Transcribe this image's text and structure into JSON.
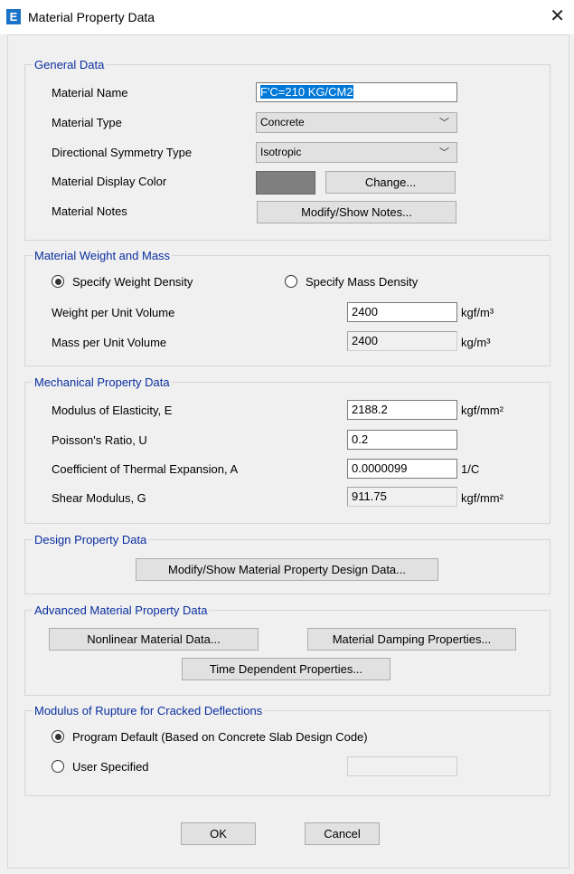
{
  "window": {
    "title": "Material Property Data",
    "icon_letter": "E",
    "close_glyph": "✕"
  },
  "general": {
    "legend": "General Data",
    "material_name_label": "Material Name",
    "material_name_value": "F'C=210 KG/CM2",
    "material_type_label": "Material Type",
    "material_type_value": "Concrete",
    "symmetry_label": "Directional Symmetry Type",
    "symmetry_value": "Isotropic",
    "display_color_label": "Material Display Color",
    "display_color": "#7f7f7f",
    "change_button": "Change...",
    "notes_label": "Material Notes",
    "notes_button": "Modify/Show Notes..."
  },
  "weight": {
    "legend": "Material Weight and Mass",
    "radio_weight": "Specify Weight Density",
    "radio_mass": "Specify Mass Density",
    "selected": "weight",
    "weight_label": "Weight per Unit Volume",
    "weight_value": "2400",
    "weight_unit": "kgf/m³",
    "mass_label": "Mass per Unit Volume",
    "mass_value": "2400",
    "mass_unit": "kg/m³"
  },
  "mechanical": {
    "legend": "Mechanical Property Data",
    "e_label": "Modulus of Elasticity,  E",
    "e_value": "2188.2",
    "e_unit": "kgf/mm²",
    "u_label": "Poisson's Ratio,  U",
    "u_value": "0.2",
    "a_label": "Coefficient of Thermal Expansion,  A",
    "a_value": "0.0000099",
    "a_unit": "1/C",
    "g_label": "Shear Modulus,  G",
    "g_value": "911.75",
    "g_unit": "kgf/mm²"
  },
  "design": {
    "legend": "Design Property Data",
    "button": "Modify/Show Material Property Design Data..."
  },
  "advanced": {
    "legend": "Advanced Material Property Data",
    "nonlinear_button": "Nonlinear Material Data...",
    "damping_button": "Material Damping Properties...",
    "time_button": "Time Dependent Properties..."
  },
  "rupture": {
    "legend": "Modulus of Rupture for Cracked Deflections",
    "radio_default": "Program Default  (Based on Concrete Slab Design Code)",
    "radio_user": "User Specified",
    "selected": "default",
    "user_value": ""
  },
  "footer": {
    "ok": "OK",
    "cancel": "Cancel"
  }
}
